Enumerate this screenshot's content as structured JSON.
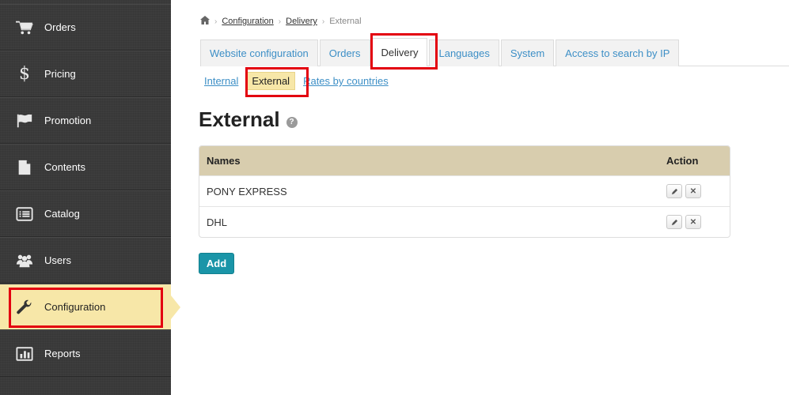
{
  "sidebar": {
    "items": [
      {
        "label": "Orders",
        "icon": "cart-icon"
      },
      {
        "label": "Pricing",
        "icon": "dollar-icon"
      },
      {
        "label": "Promotion",
        "icon": "flag-icon"
      },
      {
        "label": "Contents",
        "icon": "document-icon"
      },
      {
        "label": "Catalog",
        "icon": "list-icon"
      },
      {
        "label": "Users",
        "icon": "users-icon"
      },
      {
        "label": "Configuration",
        "icon": "wrench-icon",
        "active": true
      },
      {
        "label": "Reports",
        "icon": "bar-chart-icon"
      }
    ]
  },
  "breadcrumb": {
    "home_icon": "home-icon",
    "items": [
      "Configuration",
      "Delivery"
    ],
    "current": "External"
  },
  "tabs": [
    "Website configuration",
    "Orders",
    "Delivery",
    "Languages",
    "System",
    "Access to search by IP"
  ],
  "active_tab": "Delivery",
  "subtabs": [
    "Internal",
    "External",
    "Rates by countries"
  ],
  "active_subtab": "External",
  "page": {
    "title": "External",
    "help_icon": "question-icon"
  },
  "table": {
    "headers": {
      "names": "Names",
      "action": "Action"
    },
    "rows": [
      {
        "name": "PONY EXPRESS"
      },
      {
        "name": "DHL"
      }
    ],
    "edit_icon": "pencil-icon",
    "delete_icon": "close-icon"
  },
  "add_button": "Add",
  "colors": {
    "sidebar_bg": "#3a3a3a",
    "active_highlight": "#f7e7a8",
    "link": "#3d8fc6",
    "table_header": "#d8cdae",
    "add_button": "#1a95a8",
    "annotation_red": "#e3000f"
  }
}
